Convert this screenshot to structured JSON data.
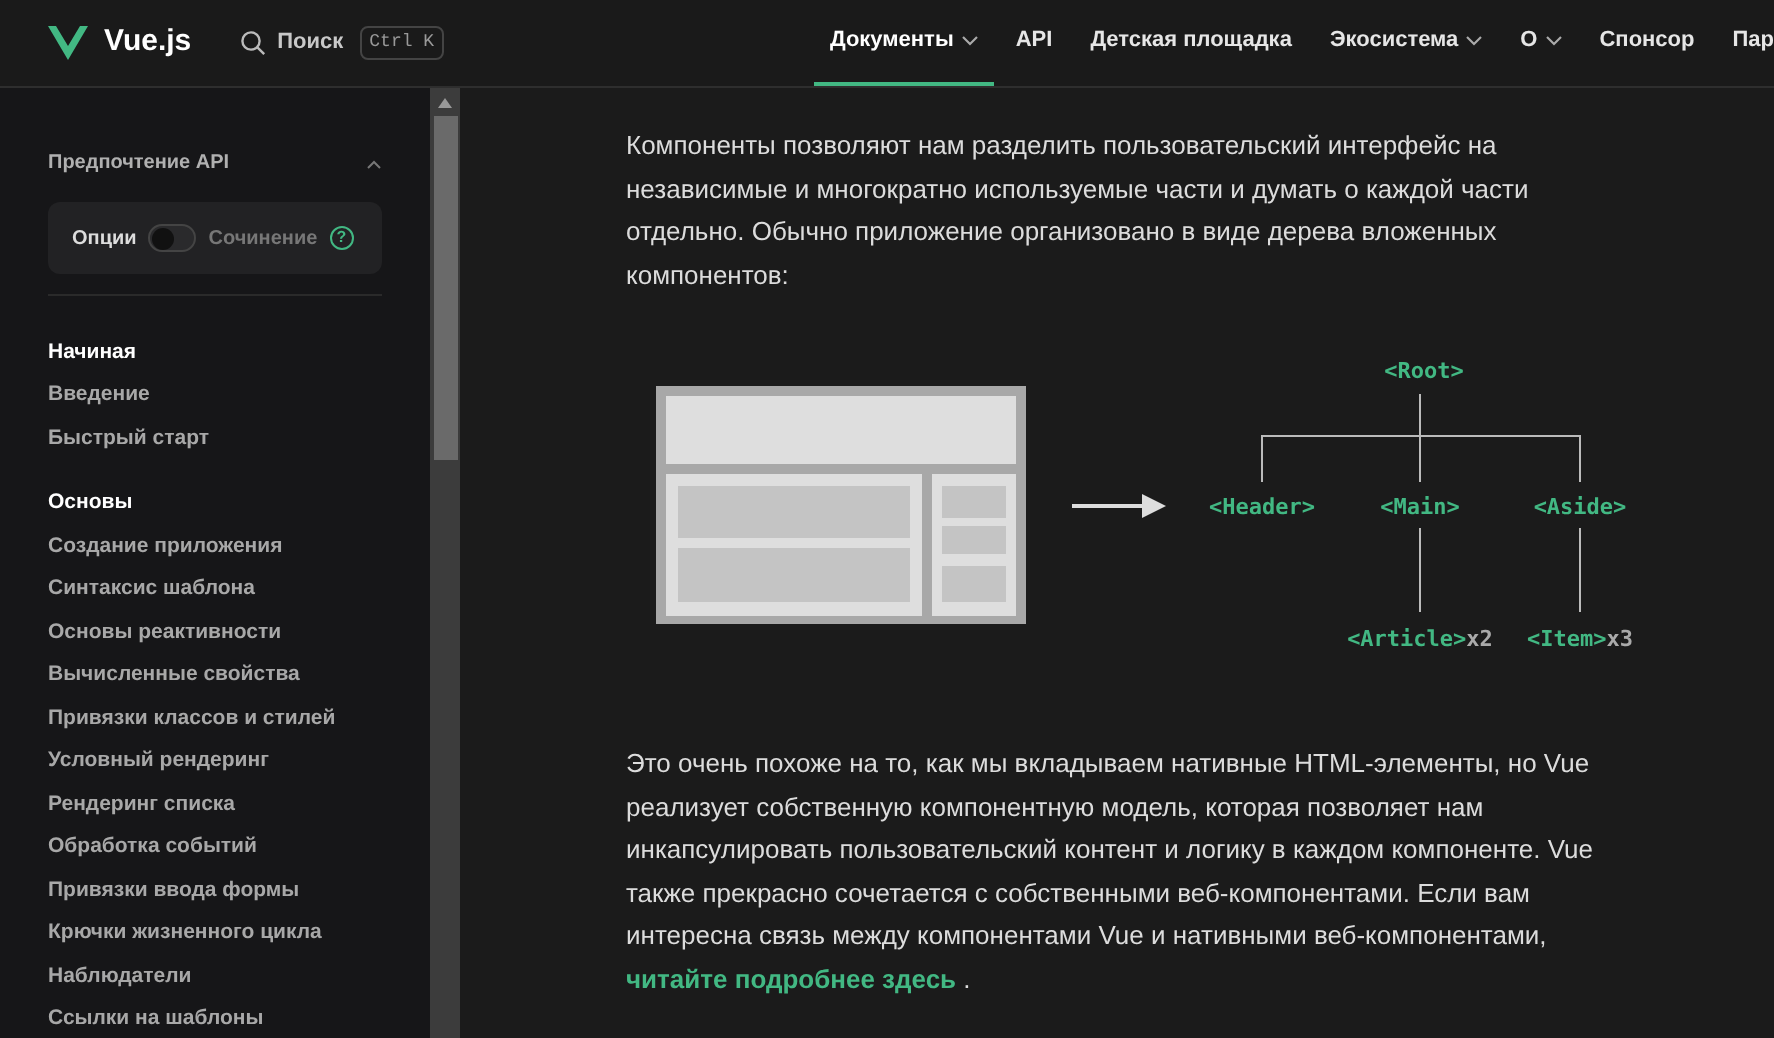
{
  "header": {
    "logo": "Vue.js",
    "search": {
      "label": "Поиск",
      "shortcut": "Ctrl K"
    },
    "nav": [
      {
        "label": "Документы",
        "menu": true,
        "selected": true
      },
      {
        "label": "API",
        "menu": false,
        "selected": false
      },
      {
        "label": "Детская площадка",
        "menu": false,
        "selected": false
      },
      {
        "label": "Экосистема",
        "menu": true,
        "selected": false
      },
      {
        "label": "О",
        "menu": true,
        "selected": false
      },
      {
        "label": "Спонсор",
        "menu": false,
        "selected": false
      },
      {
        "label": "Пар",
        "menu": false,
        "selected": false
      }
    ]
  },
  "sidebar": {
    "api_preference": {
      "title": "Предпочтение API",
      "expanded": true,
      "options_label": "Опции",
      "composition_label": "Сочинение",
      "on": false,
      "help": "?"
    },
    "sections": [
      {
        "title": "Начиная",
        "items": [
          "Введение",
          "Быстрый старт"
        ]
      },
      {
        "title": "Основы",
        "items": [
          "Создание приложения",
          "Синтаксис шаблона",
          "Основы реактивности",
          "Вычисленные свойства",
          "Привязки классов и стилей",
          "Условный рендеринг",
          "Рендеринг списка",
          "Обработка событий",
          "Привязки ввода формы",
          "Крючки жизненного цикла",
          "Наблюдатели",
          "Ссылки на шаблоны"
        ]
      }
    ]
  },
  "content": {
    "intro": "Компоненты позволяют нам разделить пользовательский интерфейс на независимые и многократно используемые части и думать о каждой части отдельно. Обычно приложение организовано в виде дерева вложенных компонентов:",
    "diagram": {
      "root": "<Root>",
      "children": [
        {
          "label": "<Header>"
        },
        {
          "label": "<Main>",
          "children": [
            {
              "label": "<Article>",
              "count": "x2"
            }
          ]
        },
        {
          "label": "<Aside>",
          "children": [
            {
              "label": "<Item>",
              "count": "x3"
            }
          ]
        }
      ]
    },
    "paragraph": "Это очень похоже на то, как мы вкладываем нативные HTML-элементы, но Vue реализует собственную компонентную модель, которая позволяет нам инкапсулировать пользовательский контент и логику в каждом компоненте. Vue также прекрасно сочетается с собственными веб-компонентами. Если вам интересна связь между компонентами Vue и нативными веб-компонентами,",
    "link": "читайте подробнее здесь",
    "after_link": "."
  }
}
